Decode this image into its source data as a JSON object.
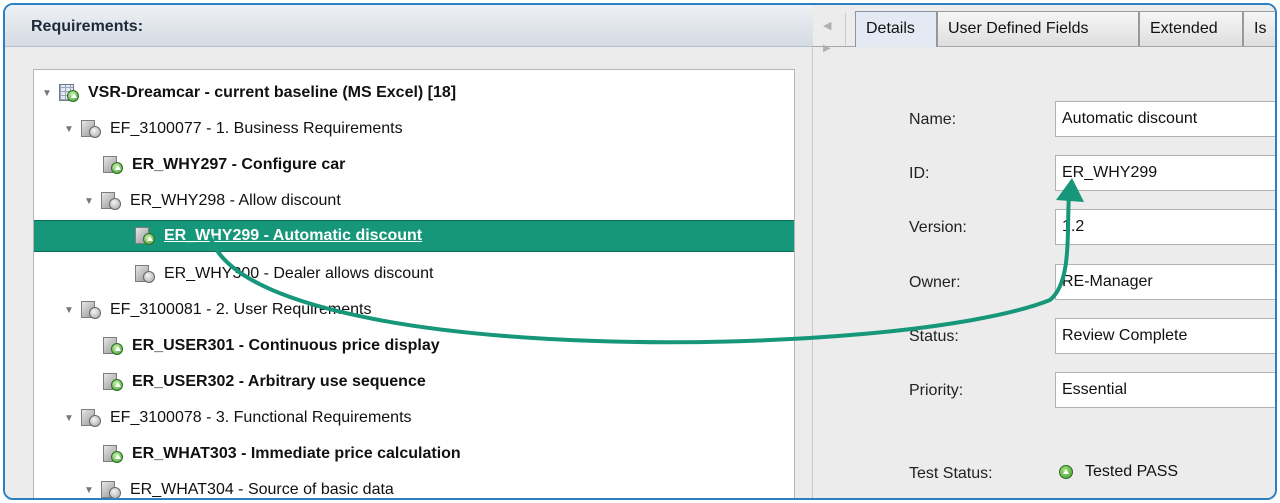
{
  "left_panel": {
    "title": "Requirements:",
    "tree": [
      {
        "label": "VSR-Dreamcar - current baseline (MS Excel) [18]",
        "expanded": true,
        "bold": true,
        "icon": "spreadsheet-icon"
      },
      {
        "label": "EF_3100077 - 1. Business Requirements",
        "expanded": true,
        "bold": false,
        "icon": "folder-requirement-icon"
      },
      {
        "label": "ER_WHY297 - Configure car",
        "expanded": null,
        "bold": true,
        "icon": "requirement-passed-icon"
      },
      {
        "label": "ER_WHY298 - Allow discount",
        "expanded": true,
        "bold": false,
        "icon": "requirement-icon"
      },
      {
        "label": "ER_WHY299 - Automatic discount",
        "expanded": null,
        "bold": true,
        "selected": true,
        "icon": "requirement-passed-icon"
      },
      {
        "label": "ER_WHY300 - Dealer allows discount",
        "expanded": null,
        "bold": false,
        "icon": "requirement-icon"
      },
      {
        "label": "EF_3100081 - 2. User Requirements",
        "expanded": true,
        "bold": false,
        "icon": "folder-requirement-icon"
      },
      {
        "label": "ER_USER301 - Continuous price display",
        "expanded": null,
        "bold": true,
        "icon": "requirement-passed-icon"
      },
      {
        "label": "ER_USER302 - Arbitrary use sequence",
        "expanded": null,
        "bold": true,
        "icon": "requirement-passed-icon"
      },
      {
        "label": "EF_3100078 - 3. Functional Requirements",
        "expanded": true,
        "bold": false,
        "icon": "folder-requirement-icon"
      },
      {
        "label": "ER_WHAT303 - Immediate price calculation",
        "expanded": null,
        "bold": true,
        "icon": "requirement-passed-icon"
      },
      {
        "label": "ER_WHAT304 - Source of basic data",
        "expanded": true,
        "bold": false,
        "icon": "requirement-icon"
      }
    ]
  },
  "right_panel": {
    "tabs": [
      "Details",
      "User Defined Fields",
      "Extended",
      "Is"
    ],
    "active_tab": "Details",
    "fields": [
      {
        "label": "Name:",
        "value": "Automatic discount"
      },
      {
        "label": "ID:",
        "value": "ER_WHY299"
      },
      {
        "label": "Version:",
        "value": "1.2"
      },
      {
        "label": "Owner:",
        "value": "RE-Manager"
      },
      {
        "label": "Status:",
        "value": "Review Complete"
      },
      {
        "label": "Priority:",
        "value": "Essential"
      }
    ],
    "test_status": {
      "label": "Test Status:",
      "value": "Tested PASS",
      "icon": "pass-status-icon"
    }
  },
  "colors": {
    "selection": "#17977a",
    "connector": "#17977a",
    "frame_border": "#2b7fc3"
  }
}
